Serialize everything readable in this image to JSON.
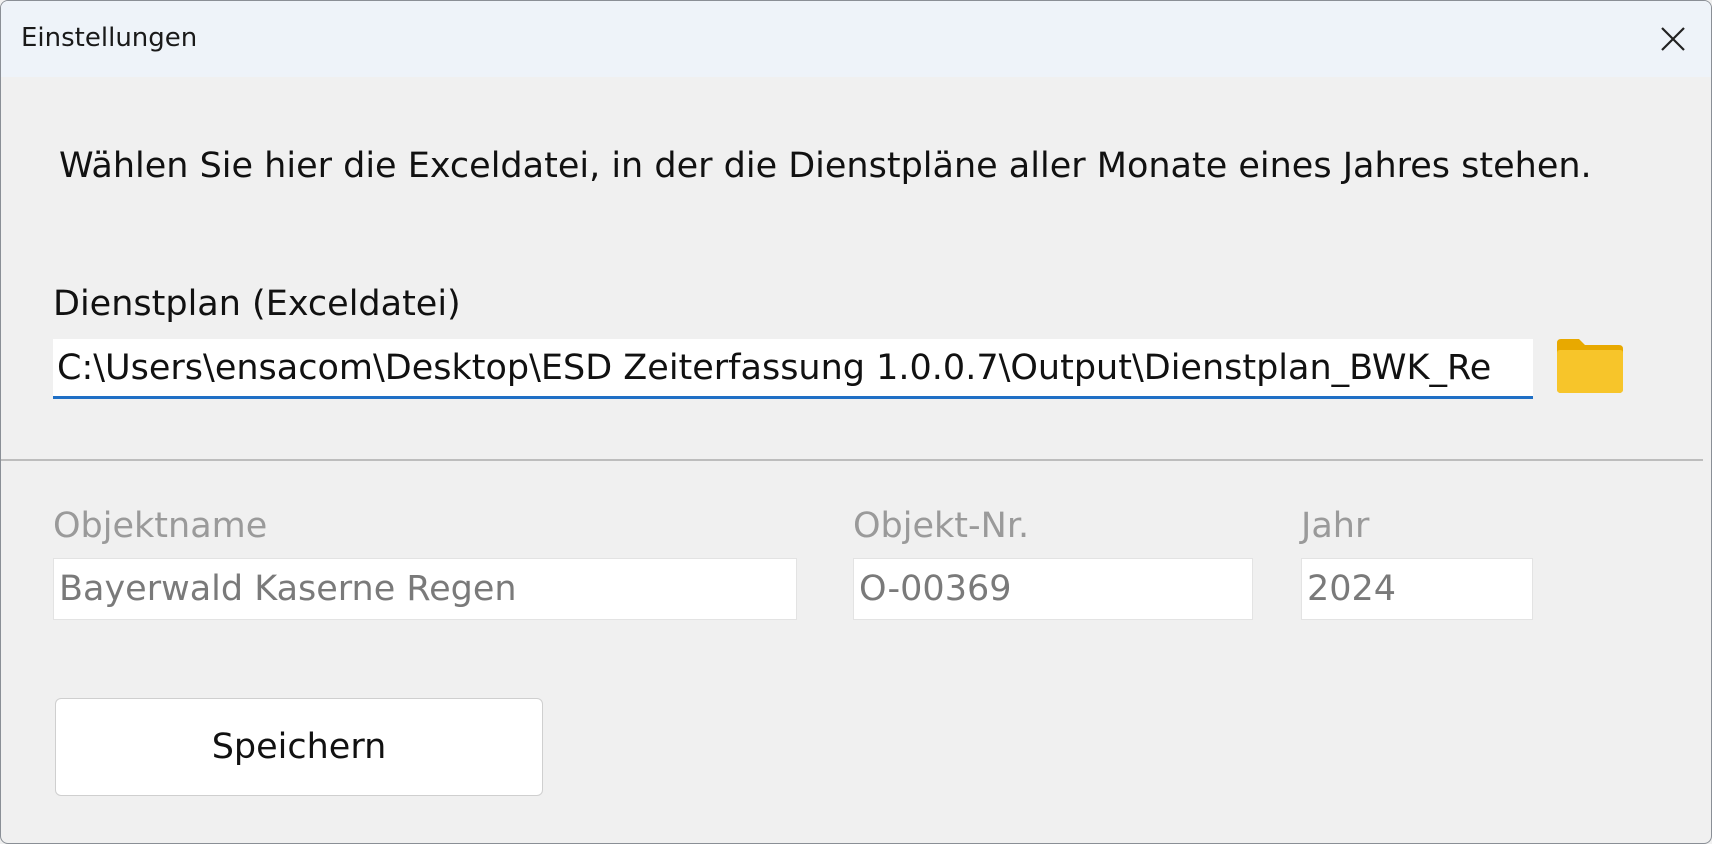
{
  "window": {
    "title": "Einstellungen"
  },
  "instruction": "Wählen Sie hier die Exceldatei, in der die Dienstpläne aller Monate eines Jahres stehen.",
  "dienstplan": {
    "label": "Dienstplan (Exceldatei)",
    "value": "C:\\Users\\ensacom\\Desktop\\ESD Zeiterfassung 1.0.0.7\\Output\\Dienstplan_BWK_Re"
  },
  "fields": {
    "objektname": {
      "label": "Objektname",
      "value": "Bayerwald Kaserne Regen"
    },
    "objekt_nr": {
      "label": "Objekt-Nr.",
      "value": "O-00369"
    },
    "jahr": {
      "label": "Jahr",
      "value": "2024"
    }
  },
  "buttons": {
    "save_label": "Speichern"
  },
  "icons": {
    "close": "close-icon",
    "folder": "folder-icon"
  },
  "colors": {
    "titlebar": "#eef3f9",
    "background": "#f0f0f0",
    "accent": "#1f6fc5",
    "folder": "#f5c125",
    "disabled_text": "#9a9a9a"
  }
}
